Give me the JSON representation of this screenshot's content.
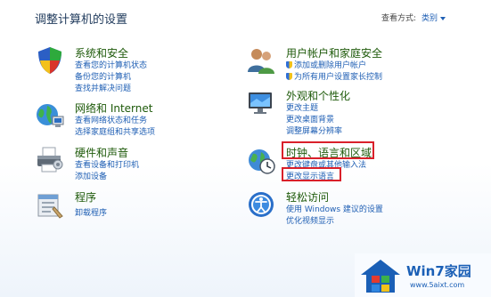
{
  "header": {
    "title": "调整计算机的设置",
    "view_label": "查看方式:",
    "view_mode": "类别"
  },
  "categories": [
    {
      "title": "系统和安全",
      "links": [
        "查看您的计算机状态",
        "备份您的计算机",
        "查找并解决问题"
      ]
    },
    {
      "title": "网络和 Internet",
      "links": [
        "查看网络状态和任务",
        "选择家庭组和共享选项"
      ]
    },
    {
      "title": "硬件和声音",
      "links": [
        "查看设备和打印机",
        "添加设备"
      ]
    },
    {
      "title": "程序",
      "links": [
        "卸载程序"
      ]
    },
    {
      "title": "用户帐户和家庭安全",
      "links": [
        "添加或删除用户帐户",
        "为所有用户设置家长控制"
      ]
    },
    {
      "title": "外观和个性化",
      "links": [
        "更改主题",
        "更改桌面背景",
        "调整屏幕分辨率"
      ]
    },
    {
      "title": "时钟、语言和区域",
      "links": [
        "更改键盘或其他输入法",
        "更改显示语言"
      ]
    },
    {
      "title": "轻松访问",
      "links": [
        "使用 Windows 建议的设置",
        "优化视频显示"
      ]
    }
  ],
  "watermark": {
    "name": "Win7家园",
    "url": "www.5aixt.com"
  },
  "colors": {
    "title_green": "#1e5a0a",
    "link_blue": "#1f5fb4",
    "highlight_red": "#d9202a"
  }
}
